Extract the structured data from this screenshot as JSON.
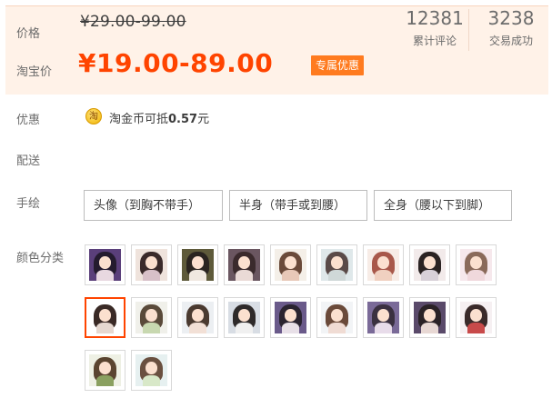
{
  "price": {
    "label": "价格",
    "original": "¥29.00-99.00",
    "sale_label": "淘宝价",
    "sale": "¥19.00-89.00",
    "tag": "专属优惠"
  },
  "stats": {
    "reviews": {
      "value": "12381",
      "label": "累计评论"
    },
    "deals": {
      "value": "3238",
      "label": "交易成功"
    }
  },
  "discount": {
    "label": "优惠",
    "icon_char": "淘",
    "text_prefix": "淘金币可抵",
    "amount": "0.57",
    "text_suffix": "元"
  },
  "delivery": {
    "label": "配送"
  },
  "handdrawn": {
    "label": "手绘",
    "options": [
      "头像（到胸不带手）",
      "半身（带手或到腰）",
      "全身（腰以下到脚）"
    ]
  },
  "colors": {
    "label": "颜色分类",
    "selected_index": 9,
    "swatches": [
      {
        "icon": "dark-haired-girl-thumb",
        "bg": "#5a3f7a",
        "hair": "#241b2e",
        "body": "#e8d8e0"
      },
      {
        "icon": "brown-haired-girl-thumb",
        "bg": "#efe3dc",
        "hair": "#3a2a2a",
        "body": "#d8c0c8"
      },
      {
        "icon": "long-hair-girl-thumb",
        "bg": "#5e5a3a",
        "hair": "#2a2420",
        "body": "#f0e8e0"
      },
      {
        "icon": "wavy-hair-girl-thumb",
        "bg": "#6a5660",
        "hair": "#3a2a2c",
        "body": "#eadad6"
      },
      {
        "icon": "chibi-girl-thumb",
        "bg": "#f4efe8",
        "hair": "#6a4a3a",
        "body": "#e8c8b8"
      },
      {
        "icon": "bun-hair-girl-thumb",
        "bg": "#dfe8ea",
        "hair": "#5a4a48",
        "body": "#cfd8d8"
      },
      {
        "icon": "curly-hair-girl-thumb",
        "bg": "#f7ece6",
        "hair": "#a8584a",
        "body": "#f0d0c0"
      },
      {
        "icon": "couple-thumb",
        "bg": "#f2eaea",
        "hair": "#2a2222",
        "body": "#d8d0d8"
      },
      {
        "icon": "pink-girl-thumb",
        "bg": "#f6e8ec",
        "hair": "#8a6a5a",
        "body": "#f0d8dc"
      },
      {
        "icon": "selfie-girl-thumb",
        "bg": "#ffffff",
        "hair": "#3a2a26",
        "body": "#e6d8d0"
      },
      {
        "icon": "green-dress-girl-thumb",
        "bg": "#f0f0ea",
        "hair": "#5a4a3a",
        "body": "#c8d8b0"
      },
      {
        "icon": "smiling-girl-thumb",
        "bg": "#eceff2",
        "hair": "#4a3a30",
        "body": "#f2e0d6"
      },
      {
        "icon": "cat-girl-thumb",
        "bg": "#d8dde4",
        "hair": "#2e2a2a",
        "body": "#f0f0f0"
      },
      {
        "icon": "purple-bg-girl-thumb",
        "bg": "#6a5a8a",
        "hair": "#2a2430",
        "body": "#e8e0e8"
      },
      {
        "icon": "fairy-girl-thumb",
        "bg": "#f2f4f6",
        "hair": "#6a4a3a",
        "body": "#f0dcd4"
      },
      {
        "icon": "purple-flower-girl-thumb",
        "bg": "#7a6a98",
        "hair": "#3a3040",
        "body": "#e8dcea"
      },
      {
        "icon": "night-girl-thumb",
        "bg": "#5a4a6a",
        "hair": "#2a2226",
        "body": "#e8d8d4"
      },
      {
        "icon": "red-dress-girl-thumb",
        "bg": "#f6f0f2",
        "hair": "#3a2a2a",
        "body": "#c84a4a"
      },
      {
        "icon": "green-sweater-girl-thumb",
        "bg": "#eef0e4",
        "hair": "#5a4430",
        "body": "#8aa060"
      },
      {
        "icon": "garden-girl-thumb",
        "bg": "#e6f0f0",
        "hair": "#6a5040",
        "body": "#d8e8c8"
      }
    ]
  },
  "theme": {
    "accent": "#ff4400",
    "tag_bg": "#ff7b1f",
    "panel_bg": "#fff2e8"
  }
}
